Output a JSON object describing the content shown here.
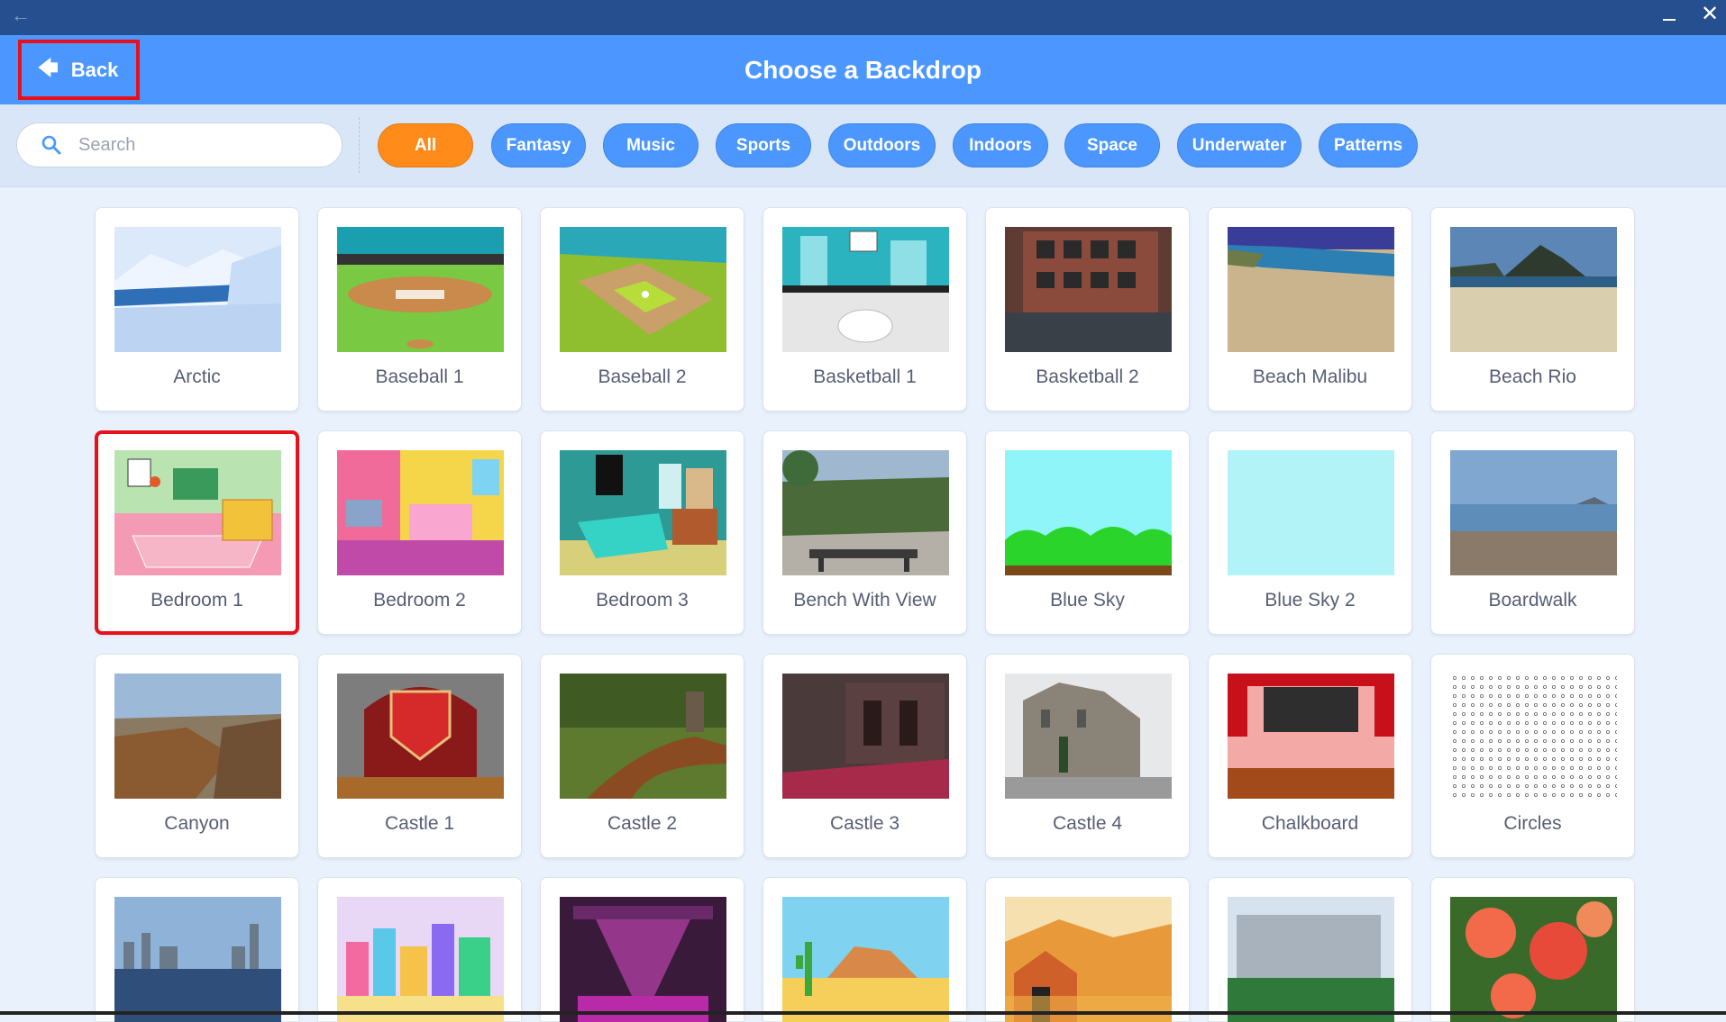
{
  "window": {
    "back_icon": "arrow-left-icon",
    "minimize_icon": "minimize-icon",
    "close_icon": "close-icon"
  },
  "header": {
    "back_label": "Back",
    "title": "Choose a Backdrop"
  },
  "search": {
    "placeholder": "Search",
    "value": ""
  },
  "tags": [
    {
      "label": "All",
      "active": true
    },
    {
      "label": "Fantasy",
      "active": false
    },
    {
      "label": "Music",
      "active": false
    },
    {
      "label": "Sports",
      "active": false
    },
    {
      "label": "Outdoors",
      "active": false
    },
    {
      "label": "Indoors",
      "active": false
    },
    {
      "label": "Space",
      "active": false
    },
    {
      "label": "Underwater",
      "active": false
    },
    {
      "label": "Patterns",
      "active": false
    }
  ],
  "backdrops": [
    "Arctic",
    "Baseball 1",
    "Baseball 2",
    "Basketball 1",
    "Basketball 2",
    "Beach Malibu",
    "Beach Rio",
    "Bedroom 1",
    "Bedroom 2",
    "Bedroom 3",
    "Bench With View",
    "Blue Sky",
    "Blue Sky 2",
    "Boardwalk",
    "Canyon",
    "Castle 1",
    "Castle 2",
    "Castle 3",
    "Castle 4",
    "Chalkboard",
    "Circles"
  ],
  "selected_backdrop": "Bedroom 1",
  "colors": {
    "header": "#4c97ff",
    "titlebar": "#264f8f",
    "active_tag": "#ff8c1a",
    "highlight": "#e8101a"
  }
}
